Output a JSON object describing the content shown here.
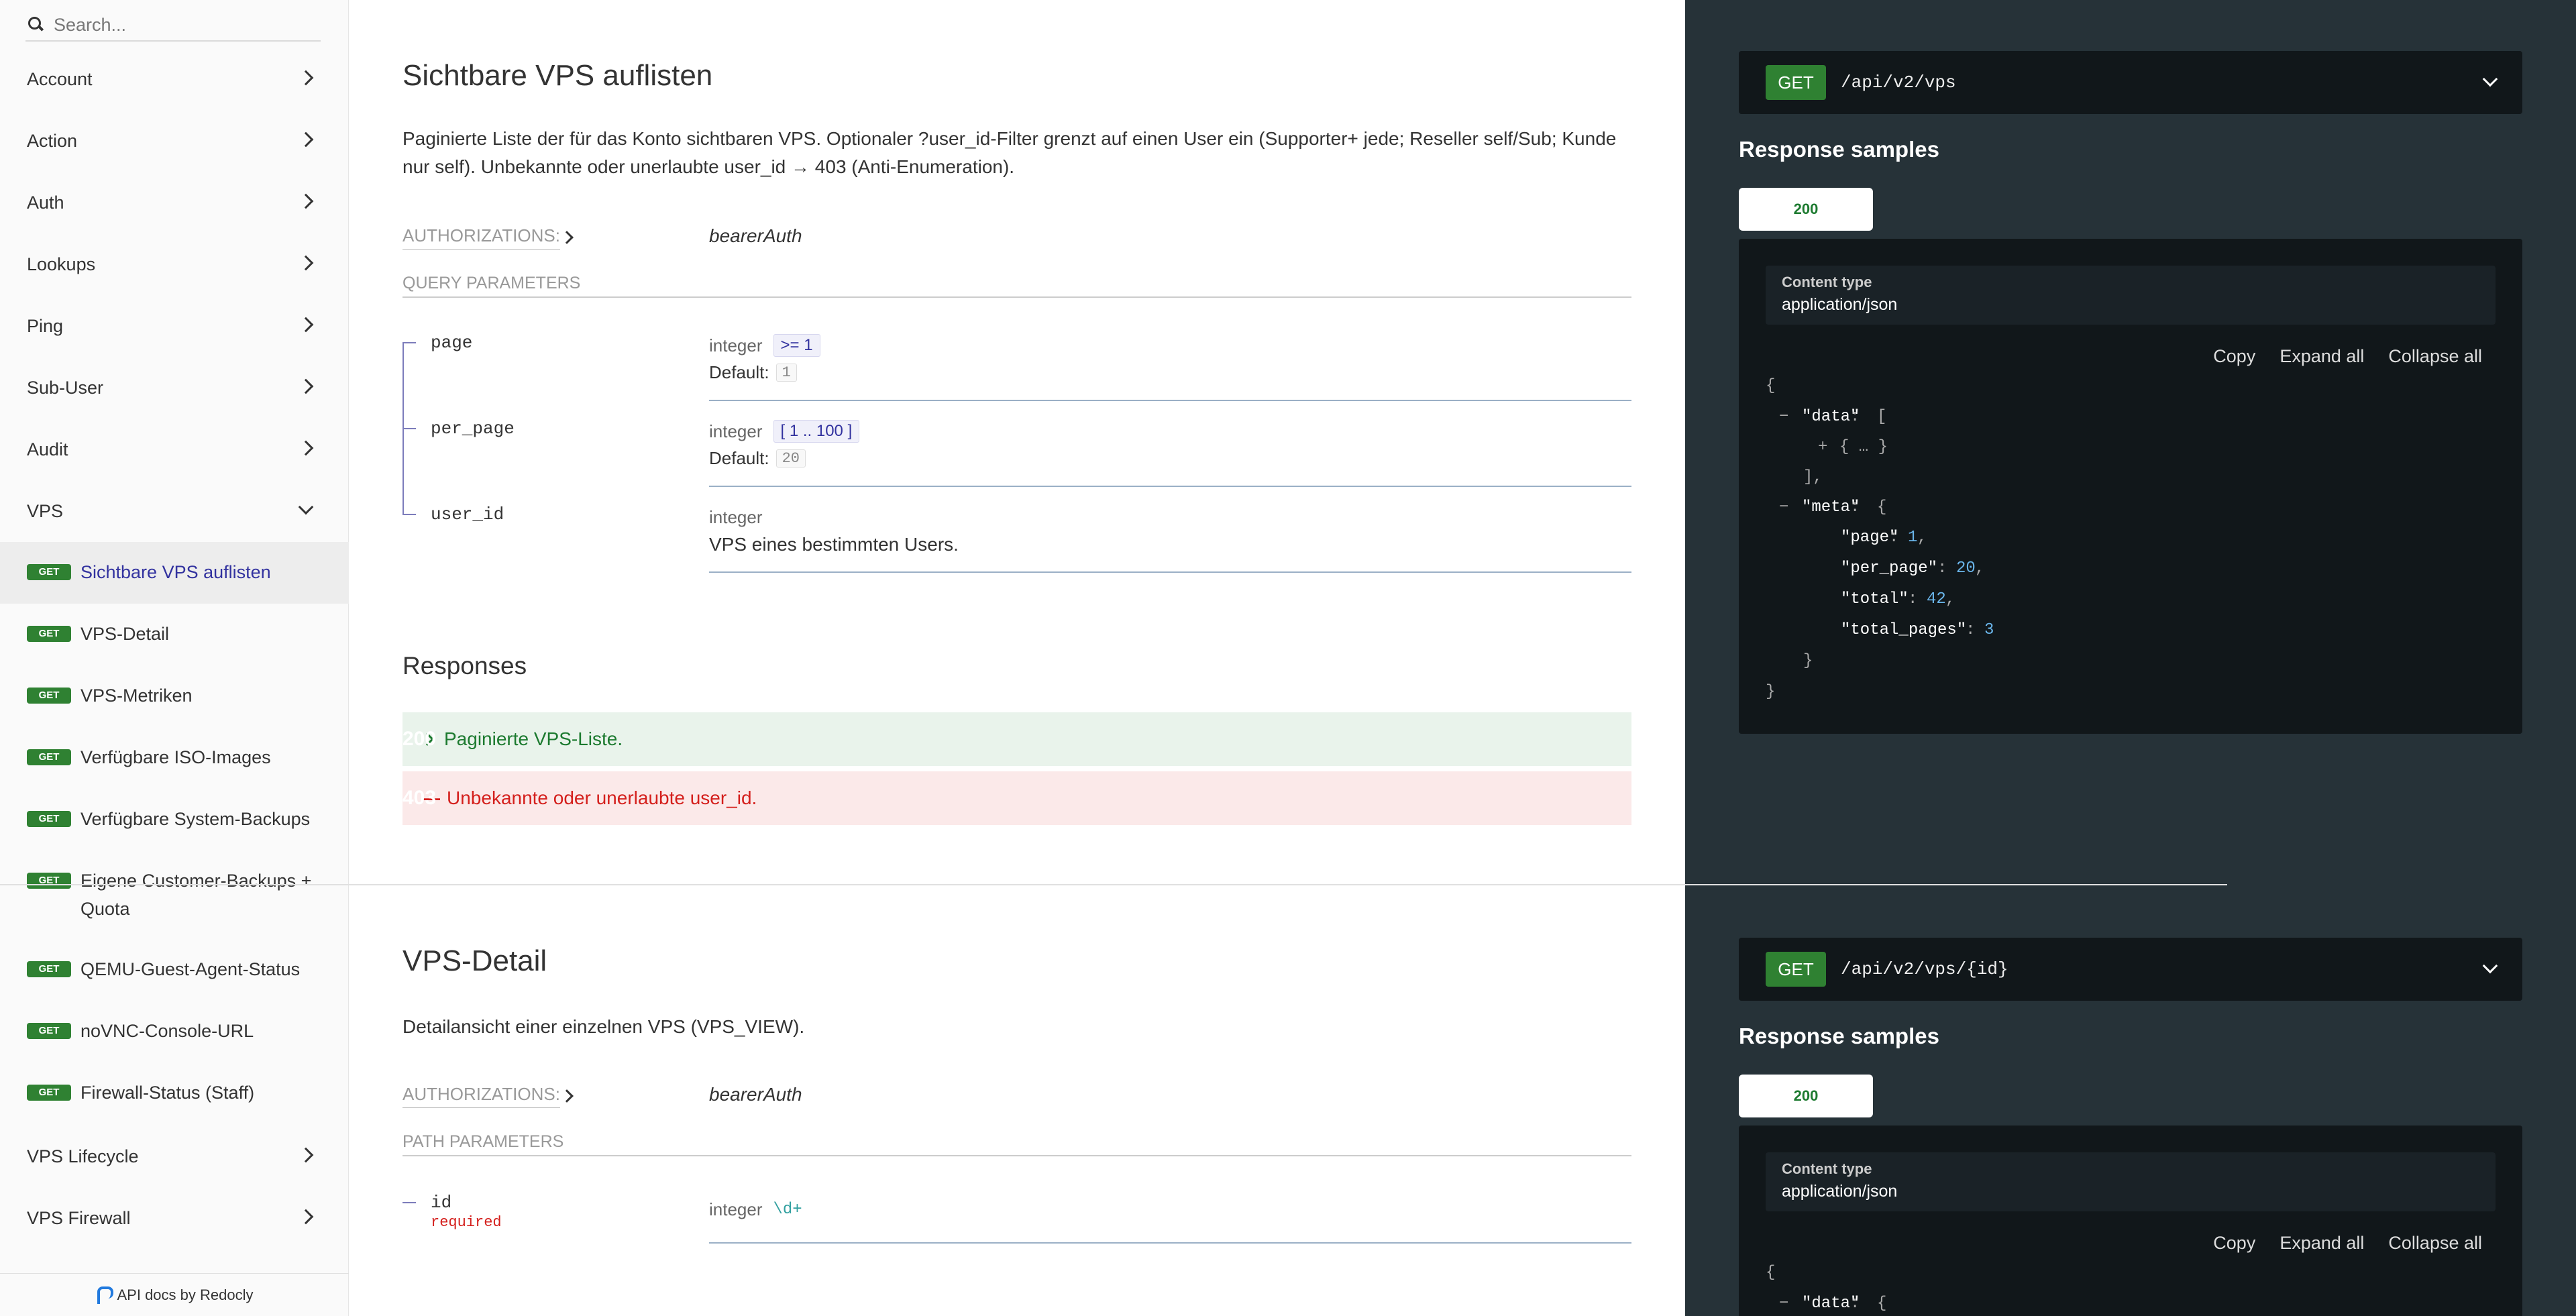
{
  "sidebar": {
    "search_placeholder": "Search...",
    "groups": {
      "account": "Account",
      "action": "Action",
      "auth": "Auth",
      "lookups": "Lookups",
      "ping": "Ping",
      "sub_user": "Sub-User",
      "audit": "Audit",
      "vps": "VPS",
      "vps_lifecycle": "VPS Lifecycle",
      "vps_firewall": "VPS Firewall"
    },
    "vps_items": [
      {
        "method": "GET",
        "label": "Sichtbare VPS auflisten"
      },
      {
        "method": "GET",
        "label": "VPS-Detail"
      },
      {
        "method": "GET",
        "label": "VPS-Metriken"
      },
      {
        "method": "GET",
        "label": "Verfügbare ISO-Images"
      },
      {
        "method": "GET",
        "label": "Verfügbare System-Backups"
      },
      {
        "method": "GET",
        "label": "Eigene Customer-Backups + Quota"
      },
      {
        "method": "GET",
        "label": "QEMU-Guest-Agent-Status"
      },
      {
        "method": "GET",
        "label": "noVNC-Console-URL"
      },
      {
        "method": "GET",
        "label": "Firewall-Status (Staff)"
      }
    ],
    "footer": "API docs by Redocly"
  },
  "op1": {
    "title": "Sichtbare VPS auflisten",
    "description_line1": "Paginierte Liste der für das Konto sichtbaren VPS. Optionaler ?user_id-Filter grenzt auf einen User ein (Supporter+ jede; Reseller self/Sub; Kunde",
    "description_line2": "nur self). Unbekannte oder unerlaubte user_id → 403 (Anti-Enumeration).",
    "auth_label": "Authorizations:",
    "auth_value": "bearerAuth",
    "params_label": "Query Parameters",
    "params": [
      {
        "name": "page",
        "type": "integer",
        "constraint": ">= 1",
        "default_label": "Default:",
        "default": "1"
      },
      {
        "name": "per_page",
        "type": "integer",
        "constraint": "[ 1 .. 100 ]",
        "default_label": "Default:",
        "default": "20"
      },
      {
        "name": "user_id",
        "type": "integer",
        "description": "VPS eines bestimmten Users."
      }
    ],
    "responses_title": "Responses",
    "responses": [
      {
        "code": "200",
        "text": "Paginierte VPS-Liste."
      },
      {
        "code": "403",
        "text": "Unbekannte oder unerlaubte user_id."
      }
    ],
    "right": {
      "method": "GET",
      "path": "/api/v2/vps",
      "samples_title": "Response samples",
      "tab": "200",
      "content_type_label": "Content type",
      "content_type": "application/json",
      "actions": [
        "Copy",
        "Expand all",
        "Collapse all"
      ]
    }
  },
  "op2": {
    "title": "VPS-Detail",
    "description": "Detailansicht einer einzelnen VPS (VPS_VIEW).",
    "auth_label": "Authorizations:",
    "auth_value": "bearerAuth",
    "params_label": "Path Parameters",
    "param": {
      "name": "id",
      "required": "required",
      "type": "integer",
      "pattern": "\\d+"
    },
    "right": {
      "method": "GET",
      "path": "/api/v2/vps/{id}",
      "samples_title": "Response samples",
      "tab": "200",
      "content_type_label": "Content type",
      "content_type": "application/json",
      "actions": [
        "Copy",
        "Expand all",
        "Collapse all"
      ]
    }
  },
  "json_sample": {
    "open_brace": "{",
    "collapse_sign": "−",
    "expand_sign": "+",
    "data_key": "\"data\"",
    "data_open": "[",
    "collapsed_obj": "{ … }",
    "data_close": "],",
    "meta_key": "\"meta\"",
    "meta_open": "{",
    "page_key": "\"page\"",
    "page_val": "1",
    "per_page_key": "\"per_page\"",
    "per_page_val": "20",
    "total_key": "\"total\"",
    "total_val": "42",
    "total_pages_key": "\"total_pages\"",
    "total_pages_val": "3",
    "meta_close": "}",
    "close_brace": "}",
    "op2_data_open": "{"
  }
}
